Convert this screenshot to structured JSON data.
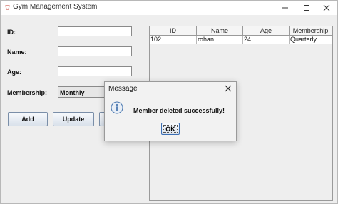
{
  "window": {
    "title": "Gym Management System"
  },
  "form": {
    "id_label": "ID:",
    "name_label": "Name:",
    "age_label": "Age:",
    "membership_label": "Membership:",
    "id_value": "",
    "name_value": "",
    "age_value": "",
    "membership_selected": "Monthly"
  },
  "buttons": {
    "add": "Add",
    "update": "Update"
  },
  "table": {
    "columns": [
      "ID",
      "Name",
      "Age",
      "Membership"
    ],
    "rows": [
      [
        "102",
        "rohan",
        "24",
        "Quarterly"
      ]
    ]
  },
  "dialog": {
    "title": "Message",
    "message": "Member deleted successfully!",
    "ok_label": "OK"
  },
  "icons": {
    "app": "java-cup-icon",
    "info": "info-icon",
    "minimize": "minimize-icon",
    "maximize": "maximize-icon",
    "close": "close-icon"
  }
}
